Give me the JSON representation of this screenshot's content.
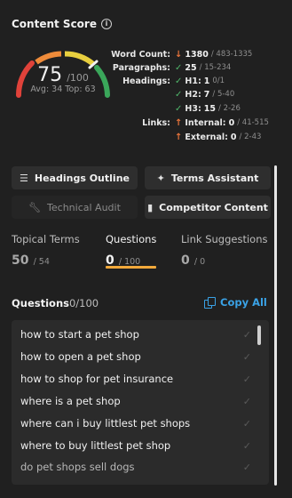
{
  "content_score": {
    "title": "Content Score",
    "info_icon": "info-icon",
    "score": "75",
    "max": "/100",
    "avg_top": "Avg: 34 Top: 63",
    "gauge_value": 0.75,
    "colors": {
      "red": "#e0423a",
      "orange": "#ee8b3a",
      "yellow": "#e8cf3f",
      "green": "#3aa65a"
    }
  },
  "stats": {
    "word_count": {
      "label": "Word Count:",
      "value": "1380",
      "range": "/ 483-1335",
      "status": "down"
    },
    "paragraphs": {
      "label": "Paragraphs:",
      "value": "25",
      "range": "/ 15-234",
      "status": "ok"
    },
    "headings": {
      "label": "Headings:",
      "h1": {
        "label": "H1:",
        "value": "1",
        "range": "0/1",
        "status": "ok"
      },
      "h2": {
        "label": "H2:",
        "value": "7",
        "range": "/ 5-40",
        "status": "ok"
      },
      "h3": {
        "label": "H3:",
        "value": "15",
        "range": "/ 2-26",
        "status": "ok"
      }
    },
    "links": {
      "label": "Links:",
      "internal": {
        "label": "Internal:",
        "value": "0",
        "range": "/ 41-515",
        "status": "up"
      },
      "external": {
        "label": "External:",
        "value": "0",
        "range": "/ 2-43",
        "status": "up"
      }
    }
  },
  "buttons": {
    "headings_outline": {
      "label": "Headings Outline",
      "icon": "list-outline-icon"
    },
    "terms_assistant": {
      "label": "Terms Assistant",
      "icon": "magic-wand-icon"
    },
    "technical_audit": {
      "label": "Technical Audit",
      "icon": "wrench-icon",
      "disabled": true
    },
    "competitor_content": {
      "label": "Competitor Content",
      "icon": "bar-chart-icon"
    }
  },
  "tabs": [
    {
      "label": "Topical Terms",
      "count": "50",
      "total": "/ 54",
      "active": false
    },
    {
      "label": "Questions",
      "count": "0",
      "total": "/ 100",
      "active": true
    },
    {
      "label": "Link Suggestions",
      "count": "0",
      "total": "/ 0",
      "active": false
    }
  ],
  "questions": {
    "title": "Questions",
    "count": "0/100",
    "copy_all": "Copy All",
    "items": [
      "how to start a pet shop",
      "how to open a pet shop",
      "how to shop for pet insurance",
      "where is a pet shop",
      "where can i buy littlest pet shops",
      "where to buy littlest pet shop",
      "do pet shops sell dogs"
    ]
  }
}
